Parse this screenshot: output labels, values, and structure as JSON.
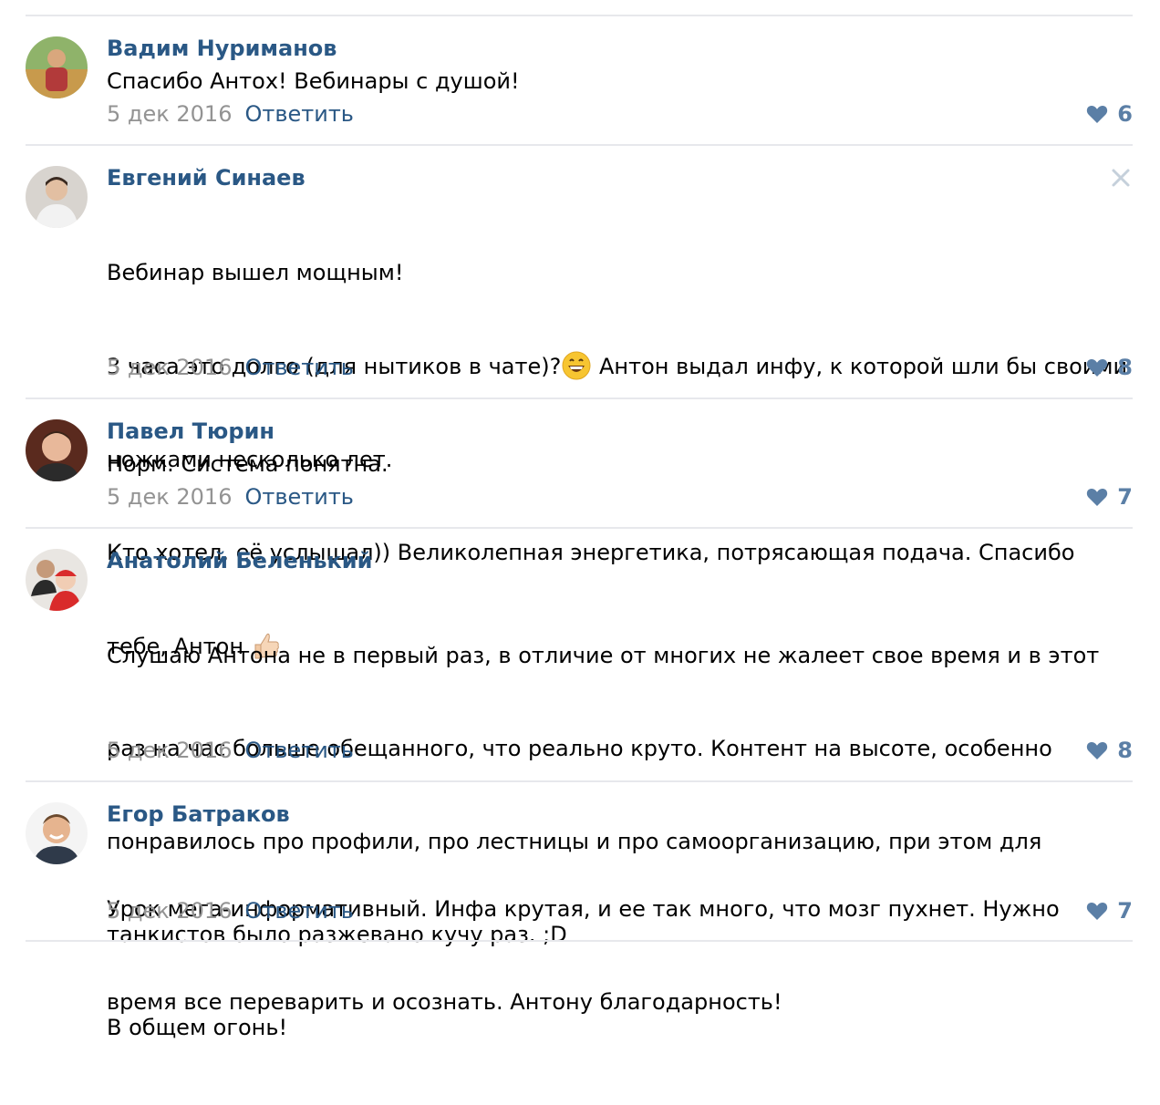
{
  "comments": [
    {
      "author": "Вадим Нуриманов",
      "avatar_icon": "user-avatar",
      "text_lines": [
        "Спасибо Антох! Вебинары с душой!"
      ],
      "date": "5 дек 2016",
      "reply_label": "Ответить",
      "likes": "6",
      "avatar_colors": [
        "#c9a45a",
        "#4a7a3a"
      ]
    },
    {
      "author": "Евгений Синаев",
      "avatar_icon": "user-avatar",
      "line1": "Вебинар вышел мощным!",
      "line2_a": "3 часа это долго (для нытиков в чате)?",
      "line2_b": " Антон выдал инфу, к которой шли бы своими",
      "line3": "ножками несколько лет.",
      "line4": "Кто хотел, её услышал)) Великолепная энергетика, потрясающая подача. Спасибо",
      "line5": "тебе, Антон ",
      "emoji_1": "grinning-face-icon",
      "emoji_2": "thumbs-up-icon",
      "date": "5 дек 2016",
      "reply_label": "Ответить",
      "likes": "8",
      "close_icon": "close-icon"
    },
    {
      "author": "Павел Тюрин",
      "avatar_icon": "user-avatar",
      "text_lines": [
        "Норм. Система понятна."
      ],
      "date": "5 дек 2016",
      "reply_label": "Ответить",
      "likes": "7"
    },
    {
      "author": "Анатолий Беленький",
      "avatar_icon": "user-avatar",
      "text_lines": [
        "Слушаю Антона не в первый раз, в отличие от многих не жалеет свое время и в этот",
        "раз на час больше обещанного, что реально круто. Контент на высоте, особенно",
        "понравилось про профили, про лестницы и про самоорганизацию, при этом для",
        "танкистов было разжевано кучу раз. ;D",
        "В общем огонь!"
      ],
      "date": "5 дек 2016",
      "reply_label": "Ответить",
      "likes": "8"
    },
    {
      "author": "Егор Батраков",
      "avatar_icon": "user-avatar",
      "text_lines": [
        "Урок мега-информативный. Инфа крутая, и ее так много, что мозг пухнет. Нужно",
        "время все переварить и осознать. Антону благодарность!"
      ],
      "date": "5 дек 2016",
      "reply_label": "Ответить",
      "likes": "7"
    }
  ],
  "colors": {
    "author": "#2a5885",
    "date": "#939393",
    "like": "#5b7fa6",
    "divider": "#e7e8ec"
  },
  "like_icon": "heart-icon"
}
